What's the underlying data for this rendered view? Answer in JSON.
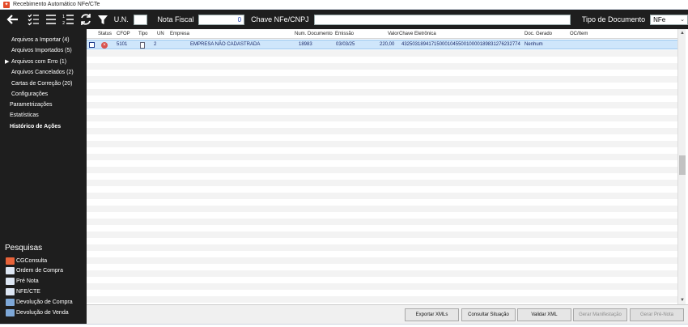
{
  "window": {
    "title": "Recebimento Automático NFe/CTe"
  },
  "toolbar": {
    "un_label": "U.N.",
    "un_value": "",
    "nota_label": "Nota Fiscal",
    "nota_value": "0",
    "chave_label": "Chave NFe/CNPJ",
    "chave_value": "",
    "tipo_label": "Tipo de Documento",
    "tipo_value": "NFe"
  },
  "sidebar": {
    "items": [
      {
        "label": "Arquivos a Importar (4)"
      },
      {
        "label": "Arquivos Importados (5)"
      },
      {
        "label": "Arquivos com Erro (1)"
      },
      {
        "label": "Arquivos Cancelados (2)"
      },
      {
        "label": "Cartas de Correção (20)"
      },
      {
        "label": "Configurações"
      },
      {
        "label": "Parametrizações"
      },
      {
        "label": "Estatísticas"
      },
      {
        "label": "Histórico de Ações"
      }
    ],
    "pesquisas_title": "Pesquisas",
    "pesquisas": [
      {
        "label": "CGConsulta",
        "color": "#e8633a"
      },
      {
        "label": "Ordem de Compra",
        "color": "#dde6f3"
      },
      {
        "label": "Pré Nota",
        "color": "#dde6f3"
      },
      {
        "label": "NFE/CTE",
        "color": "#dde6f3"
      },
      {
        "label": "Devolução de Compra",
        "color": "#7ea8d8"
      },
      {
        "label": "Devolução de Venda",
        "color": "#7ea8d8"
      }
    ]
  },
  "grid": {
    "columns": [
      "Status",
      "CFOP",
      "Tipo",
      "UN",
      "Empresa",
      "Num. Documento",
      "Emissão",
      "Valor",
      "Chave Eletrônica",
      "Doc. Gerado",
      "OC/Item"
    ],
    "rows": [
      {
        "cfop": "5101",
        "un": "2",
        "empresa": "EMPRESA NÃO CADASTRADA",
        "num_documento": "18983",
        "emissao": "03/03/25",
        "valor": "220,00",
        "chave": "43250318941715000104550010000189831276232774",
        "doc_gerado": "Nenhum",
        "oc_item": ""
      }
    ]
  },
  "footer": {
    "buttons": [
      {
        "label": "Exportar XMLs",
        "enabled": true
      },
      {
        "label": "Consultar Situação",
        "enabled": true
      },
      {
        "label": "Validar XML",
        "enabled": true
      },
      {
        "label": "Gerar Manifestação",
        "enabled": false
      },
      {
        "label": "Gerar Pré-Nota",
        "enabled": false
      }
    ]
  },
  "colors": {
    "dark_bg": "#1e1e1e",
    "selected_row": "#cfe6fb",
    "stripe": "#f3f3f3",
    "error_status": "#d9534f"
  }
}
